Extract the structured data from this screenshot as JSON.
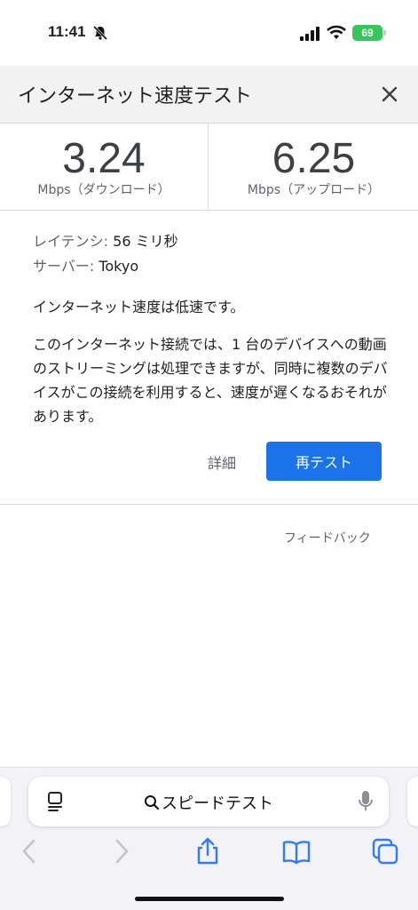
{
  "status_bar": {
    "time": "11:41",
    "battery": "69",
    "icons": [
      "bell-slash-icon",
      "cellular-signal-icon",
      "wifi-icon",
      "battery-icon"
    ]
  },
  "header": {
    "title": "インターネット速度テスト",
    "close_icon": "close-icon"
  },
  "speed": {
    "download": {
      "value": "3.24",
      "unit": "Mbps（ダウンロード）"
    },
    "upload": {
      "value": "6.25",
      "unit": "Mbps（アップロード）"
    }
  },
  "details": {
    "latency_label": "レイテンシ:",
    "latency_value": "56 ミリ秒",
    "server_label": "サーバー:",
    "server_value": "Tokyo",
    "summary": "インターネット速度は低速です。",
    "description": "このインターネット接続では、1 台のデバイスへの動画のストリーミングは処理できますが、同時に複数のデバイスがこの接続を利用すると、速度が遅くなるおそれがあります。",
    "more_label": "詳細",
    "retest_label": "再テスト"
  },
  "feedback_label": "フィードバック",
  "safari": {
    "address_text": "スピードテスト",
    "icons": [
      "reader-icon",
      "search-icon",
      "microphone-icon",
      "back-icon",
      "forward-icon",
      "share-icon",
      "bookmarks-icon",
      "tabs-icon"
    ],
    "accent": "#1a73e8",
    "toolbar_blue": "#2f7cf6"
  }
}
